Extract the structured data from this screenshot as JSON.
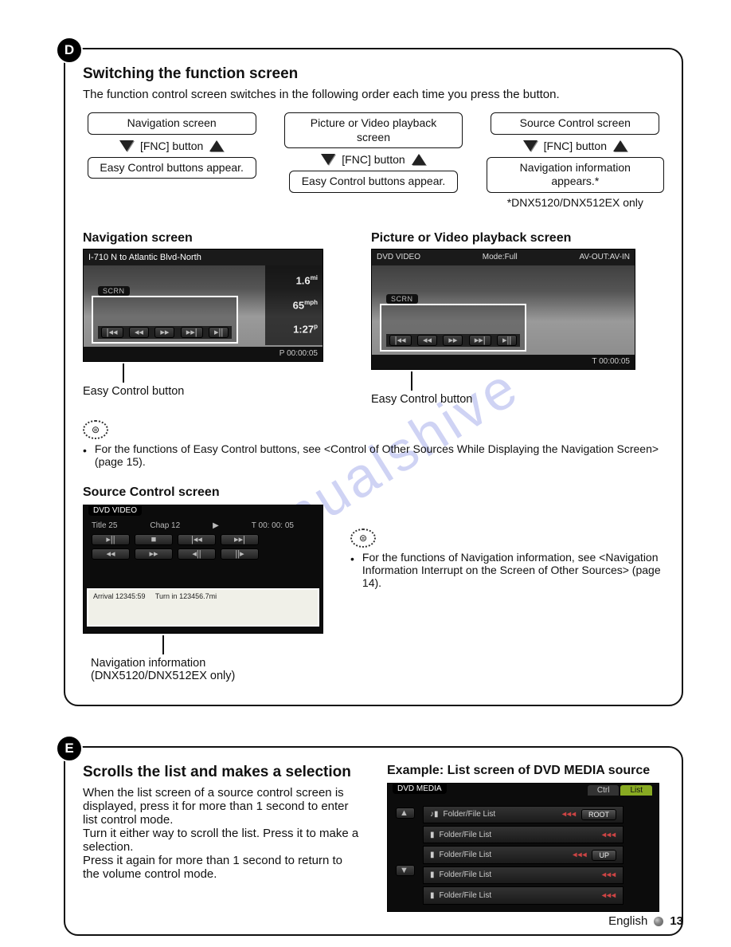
{
  "watermark": "manualshive",
  "sectionD": {
    "badge": "D",
    "title": "Switching the function screen",
    "intro": "The function control screen switches in the following order each time you press the button.",
    "flows": [
      {
        "top": "Navigation screen",
        "button": "[FNC] button",
        "bottom": "Easy Control buttons appear."
      },
      {
        "top": "Picture or Video playback screen",
        "button": "[FNC] button",
        "bottom": "Easy Control buttons appear."
      },
      {
        "top": "Source Control screen",
        "button": "[FNC] button",
        "bottom": "Navigation information appears.*"
      }
    ],
    "flowFootnote": "*DNX5120/DNX512EX only",
    "nav": {
      "title": "Navigation screen",
      "direction": "I-710 N to Atlantic Blvd-North",
      "dist": "1.6",
      "speed": "65",
      "eta": "1:27",
      "time": "P 00:00:05",
      "overlayTab": "SCRN",
      "caption": "Easy Control button"
    },
    "video": {
      "title": "Picture or Video playback screen",
      "barLeft": "DVD VIDEO",
      "barMid": "Mode:Full",
      "barRight": "AV-OUT:AV-IN",
      "time": "T 00:00:05",
      "overlayTab": "SCRN",
      "caption": "Easy Control button"
    },
    "note1": "For the functions of Easy Control buttons, see <Control of Other Sources While Displaying the Navigation Screen> (page 15).",
    "source": {
      "title": "Source Control screen",
      "pill": "DVD VIDEO",
      "info": {
        "title": "Title    25",
        "chap": "Chap   12",
        "play": "▶",
        "time": "T   00: 00: 05"
      },
      "panel": {
        "arrival": "Arrival    12345:59",
        "turn": "Turn in   123456.7mi"
      },
      "caption": "Navigation information (DNX5120/DNX512EX only)"
    },
    "note2": "For the functions of Navigation information, see <Navigation Information Interrupt on the Screen of Other Sources> (page 14)."
  },
  "sectionE": {
    "badge": "E",
    "title": "Scrolls the list and makes a selection",
    "p1": "When the list screen of a source control screen is displayed, press it for more than 1 second to enter list control mode.",
    "p2": "Turn it either way to scroll the list. Press it to make a selection.",
    "p3": "Press it again for more than 1 second to return to the volume control mode.",
    "exampleTitle": "Example: List screen of DVD MEDIA source",
    "media": {
      "pill": "DVD MEDIA",
      "tabCtrl": "Ctrl",
      "tabList": "List",
      "rowLabel": "Folder/File List",
      "btnRoot": "ROOT",
      "btnUp": "UP"
    }
  },
  "footer": {
    "lang": "English",
    "page": "13"
  }
}
